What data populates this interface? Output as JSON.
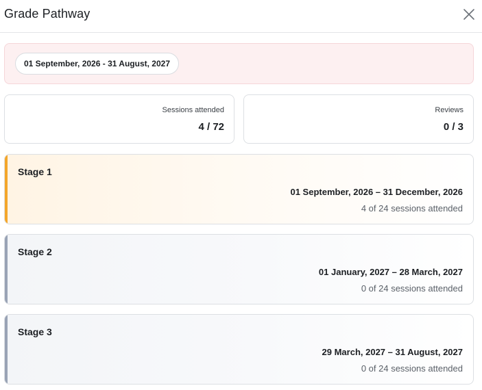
{
  "dialog": {
    "title": "Grade Pathway",
    "close_icon": "close-icon"
  },
  "period": {
    "label": "01 September, 2026 - 31 August, 2027"
  },
  "stats": [
    {
      "label": "Sessions attended",
      "value": "4 / 72"
    },
    {
      "label": "Reviews",
      "value": "0 / 3"
    }
  ],
  "stages": [
    {
      "name": "Stage 1",
      "dates": "01 September, 2026 – 31 December, 2026",
      "sessions": "4 of 24 sessions attended",
      "status": "current",
      "accent_color": "#f4a62a"
    },
    {
      "name": "Stage 2",
      "dates": "01 January, 2027 – 28 March, 2027",
      "sessions": "0 of 24 sessions attended",
      "status": "upcoming",
      "accent_color": "#99a3b5"
    },
    {
      "name": "Stage 3",
      "dates": "29 March, 2027 – 31 August, 2027",
      "sessions": "0 of 24 sessions attended",
      "status": "upcoming",
      "accent_color": "#99a3b5"
    }
  ],
  "colors": {
    "period_banner_bg": "#fdf0f1",
    "current_accent": "#f4a62a",
    "upcoming_accent": "#99a3b5"
  }
}
